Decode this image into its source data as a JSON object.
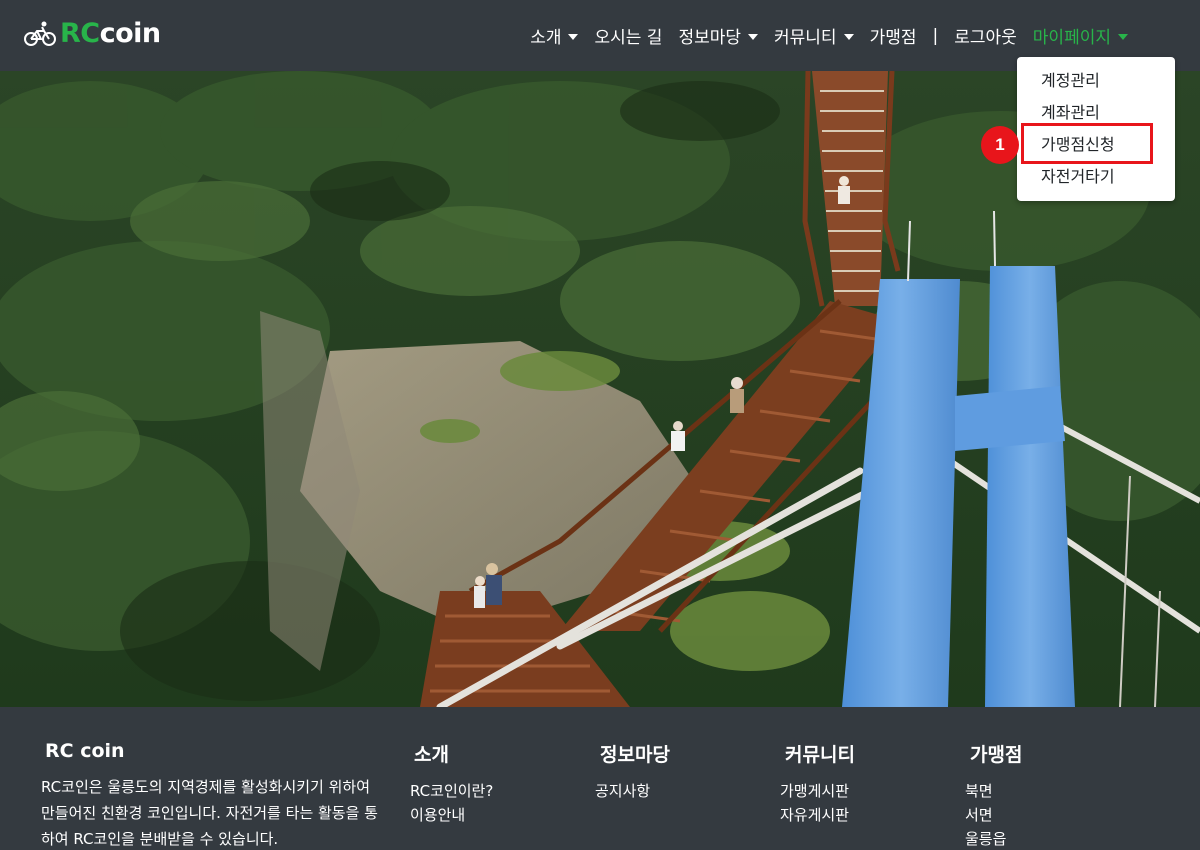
{
  "brand": {
    "rc": "RC",
    "coin": "coin",
    "icon": "bicycle-icon"
  },
  "nav": {
    "items": [
      {
        "label": "소개",
        "dropdown": true
      },
      {
        "label": "오시는 길",
        "dropdown": false
      },
      {
        "label": "정보마당",
        "dropdown": true
      },
      {
        "label": "커뮤니티",
        "dropdown": true
      },
      {
        "label": "가맹점",
        "dropdown": false
      }
    ],
    "separator": "|",
    "logout": "로그아웃",
    "mypage": "마이페이지"
  },
  "dropdown": {
    "items": [
      "계정관리",
      "계좌관리",
      "가맹점신청",
      "자전거타기"
    ],
    "highlighted_index": 2,
    "step_number": "1"
  },
  "footer": {
    "about": {
      "title": "RC coin",
      "desc": "RC코인은 울릉도의 지역경제를 활성화시키기 위하여 만들어진 친환경 코인입니다. 자전거를 타는 활동을 통하여 RC코인을 분배받을 수 있습니다."
    },
    "columns": [
      {
        "title": "소개",
        "links": [
          "RC코인이란?",
          "이용안내"
        ]
      },
      {
        "title": "정보마당",
        "links": [
          "공지사항"
        ]
      },
      {
        "title": "커뮤니티",
        "links": [
          "가맹게시판",
          "자유게시판"
        ]
      },
      {
        "title": "가맹점",
        "links": [
          "북면",
          "서면",
          "울릉읍"
        ]
      }
    ]
  },
  "colors": {
    "accent": "#28b44a",
    "navbar": "#343a40",
    "highlight": "#e8151b"
  }
}
